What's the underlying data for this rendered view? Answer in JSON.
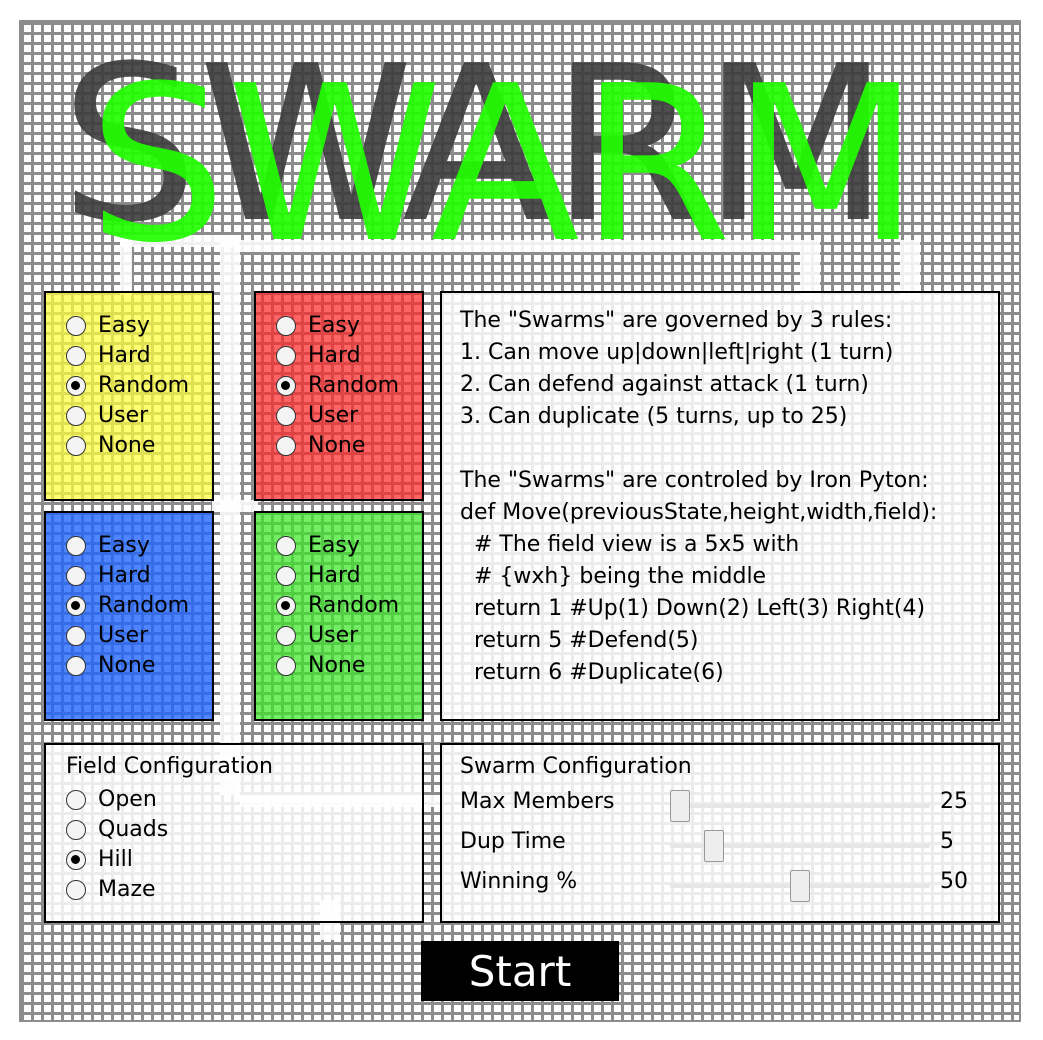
{
  "app": {
    "title": "SWARM",
    "title_color": "#22ff00",
    "shadow_color": "#3c3c3c"
  },
  "teams": [
    {
      "color_name": "yellow",
      "color": "#ffff3c",
      "options": [
        {
          "label": "Easy",
          "checked": false
        },
        {
          "label": "Hard",
          "checked": false
        },
        {
          "label": "Random",
          "checked": true
        },
        {
          "label": "User",
          "checked": false
        },
        {
          "label": "None",
          "checked": false
        }
      ]
    },
    {
      "color_name": "red",
      "color": "#ff2828",
      "options": [
        {
          "label": "Easy",
          "checked": false
        },
        {
          "label": "Hard",
          "checked": false
        },
        {
          "label": "Random",
          "checked": true
        },
        {
          "label": "User",
          "checked": false
        },
        {
          "label": "None",
          "checked": false
        }
      ]
    },
    {
      "color_name": "blue",
      "color": "#1e64ff",
      "options": [
        {
          "label": "Easy",
          "checked": false
        },
        {
          "label": "Hard",
          "checked": false
        },
        {
          "label": "Random",
          "checked": true
        },
        {
          "label": "User",
          "checked": false
        },
        {
          "label": "None",
          "checked": false
        }
      ]
    },
    {
      "color_name": "green",
      "color": "#3ce628",
      "options": [
        {
          "label": "Easy",
          "checked": false
        },
        {
          "label": "Hard",
          "checked": false
        },
        {
          "label": "Random",
          "checked": true
        },
        {
          "label": "User",
          "checked": false
        },
        {
          "label": "None",
          "checked": false
        }
      ]
    }
  ],
  "rules": {
    "lines": [
      "The \"Swarms\" are governed by 3 rules:",
      "1. Can move up|down|left|right (1 turn)",
      "2. Can defend against attack (1 turn)",
      "3. Can duplicate (5 turns, up to 25)",
      "",
      "The \"Swarms\" are controled by Iron Pyton:",
      "def Move(previousState,height,width,field):",
      "  # The field view is a 5x5 with",
      "  # {wxh} being the middle",
      "  return 1 #Up(1) Down(2) Left(3) Right(4)",
      "  return 5 #Defend(5)",
      "  return 6 #Duplicate(6)"
    ]
  },
  "field_config": {
    "heading": "Field Configuration",
    "options": [
      {
        "label": "Open",
        "checked": false
      },
      {
        "label": "Quads",
        "checked": false
      },
      {
        "label": "Hill",
        "checked": true
      },
      {
        "label": "Maze",
        "checked": false
      }
    ]
  },
  "swarm_config": {
    "heading": "Swarm Configuration",
    "sliders": [
      {
        "label": "Max Members",
        "value": "25",
        "level": 0.04
      },
      {
        "label": "Dup Time",
        "value": "5",
        "level": 0.17
      },
      {
        "label": "Winning %",
        "value": "50",
        "level": 0.5
      }
    ]
  },
  "start_label": "Start"
}
